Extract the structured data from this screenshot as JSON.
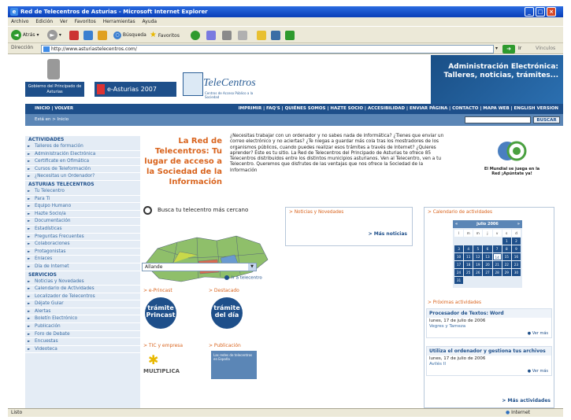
{
  "window": {
    "title": "Red de Telecentros de Asturias - Microsoft Internet Explorer"
  },
  "menu": [
    "Archivo",
    "Edición",
    "Ver",
    "Favoritos",
    "Herramientas",
    "Ayuda"
  ],
  "toolbar": {
    "back_label": "Atrás",
    "search_label": "Búsqueda",
    "favorites_label": "Favoritos"
  },
  "address": {
    "label": "Dirección",
    "url": "http://www.asturiastelecentros.com/",
    "go_label": "Ir",
    "links_label": "Vínculos"
  },
  "status": {
    "text": "Listo",
    "zone": "Internet"
  },
  "header": {
    "gobierno_logo": "Gobierno del Principado de Asturias",
    "asturias2007": "e-Asturias 2007",
    "telecentros_logo": "TeleCentros",
    "telecentros_sub": "Centros de Acceso Público a la Sociedad",
    "admin_banner": "Administración Electrónica: Talleres, noticias, trámites..."
  },
  "nav": {
    "left": "INICIO | VOLVER",
    "right": "IMPRIMIR | FAQ'S | QUIÉNES SOMOS | HAZTE SOCIO | ACCESIBILIDAD | ENVIAR PÁGINA | CONTACTO | MAPA WEB | ENGLISH VERSION"
  },
  "subbar": {
    "breadcrumb": "Está en > Inicio",
    "search_button": "BUSCAR"
  },
  "sidebar": {
    "sections": [
      {
        "heading": "ACTIVIDADES",
        "items": [
          "Talleres de formación",
          "Administración Electrónica",
          "Certificate en Ofimática",
          "Cursos de Teleformación",
          "¿Necesitas un Ordenador?"
        ]
      },
      {
        "heading": "ASTURIAS TELECENTROS",
        "items": [
          "Tu Telecentro",
          "Para Ti",
          "Equipo Humano",
          "Hazte Socio/a",
          "Documentación",
          "Estadísticas",
          "Preguntas Frecuentes",
          "Colaboraciones",
          "Protagonistas",
          "Enlaces",
          "Día de Internet"
        ]
      },
      {
        "heading": "SERVICIOS",
        "items": [
          "Noticias y Novedades",
          "Calendario de Actividades",
          "Localizador de Telecentros",
          "Déjate Guiar",
          "Alertas",
          "Boletín Electrónico",
          "Publicación",
          "Foro de Debate",
          "Encuestas",
          "Videoteca"
        ]
      }
    ]
  },
  "intro": {
    "title": "La Red de Telecentros: Tu lugar de acceso a la Sociedad de la Información",
    "text": "¿Necesitas trabajar con un ordenador y no sabes nada de informática? ¿Tienes que enviar un correo electrónico y no aciertas? ¿Te niegas a guardar más cola tras los mostradores de los organismos públicos, cuando puedes realizar esos trámites a través de Internet? ¿Quieres aprender? Éste es tu sitio. La Red de Telecentros del Principado de Asturias te ofrece 85 Telecentros distribuidos entre los distintos municipios asturianos. Ven al Telecentro, ven a tu Telecentro. Queremos que disfrutes de las ventajas que nos ofrece la Sociedad de la Información",
    "mundial_text": "El Mundial se juega en la Red ¡Apúntate ya!"
  },
  "finder": {
    "title": "Busca tu telecentro más cercano",
    "selected": "Allande",
    "go_label": "Ir a telecentro"
  },
  "promos": {
    "eprincast_head": "> e-Princast",
    "eprincast_img": "trámite Princast",
    "destacado_head": "> Destacado",
    "destacado_img": "trámite del día",
    "tic_head": "> TIC y empresa",
    "multiplica": "MULTIPLICA",
    "publicacion_head": "> Publicación",
    "publicacion_img": "Las redes de telecentros en España"
  },
  "news": {
    "title": "> Noticias y Novedades",
    "more": "> Más noticias"
  },
  "calendar": {
    "title": "> Calendario de actividades",
    "month": "julio 2006",
    "weekdays": [
      "l",
      "m",
      "m",
      "j",
      "v",
      "s",
      "d"
    ],
    "days": [
      "",
      "",
      "",
      "",
      "",
      "1",
      "2",
      "3",
      "4",
      "5",
      "6",
      "7",
      "8",
      "9",
      "10",
      "11",
      "12",
      "13",
      "14",
      "15",
      "16",
      "17",
      "18",
      "19",
      "20",
      "21",
      "22",
      "23",
      "24",
      "25",
      "26",
      "27",
      "28",
      "29",
      "30",
      "31",
      "",
      "",
      "",
      "",
      "",
      ""
    ],
    "today": "14"
  },
  "activities": {
    "title": "> Próximas actividades",
    "items": [
      {
        "title": "Procesador de Textos: Word",
        "date": "lunes, 17 de julio de 2006",
        "place": "Vegres y Tameza",
        "more": "Ver más"
      },
      {
        "title": "Utiliza el ordenador y gestiona tus archivos",
        "date": "lunes, 17 de julio de 2006",
        "place": "Avilés II",
        "more": "Ver más"
      }
    ],
    "more": "> Más actividades"
  }
}
